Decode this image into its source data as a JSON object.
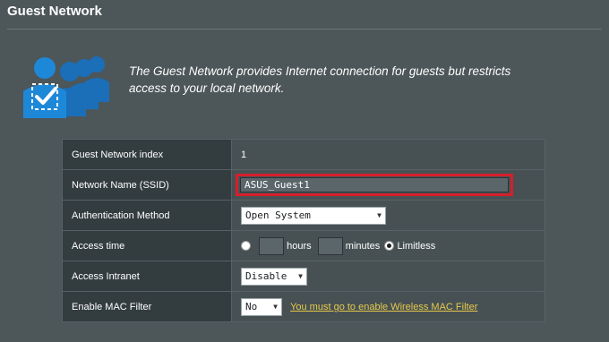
{
  "header": {
    "title": "Guest Network"
  },
  "intro": {
    "icon": "guest-users-check-icon",
    "text": "The Guest Network provides Internet connection for guests but restricts access to your local network."
  },
  "form": {
    "index": {
      "label": "Guest Network index",
      "value": "1"
    },
    "ssid": {
      "label": "Network Name (SSID)",
      "value": "ASUS_Guest1"
    },
    "auth": {
      "label": "Authentication Method",
      "value": "Open System"
    },
    "access_time": {
      "label": "Access time",
      "hours_label": "hours",
      "minutes_label": "minutes",
      "limitless_label": "Limitless",
      "selected": "Limitless"
    },
    "intranet": {
      "label": "Access Intranet",
      "value": "Disable"
    },
    "mac_filter": {
      "label": "Enable MAC Filter",
      "value": "No",
      "link_text": "You must go to enable Wireless MAC Filter"
    }
  },
  "colors": {
    "background": "#4d5659",
    "highlight_border": "#d61f2a",
    "link": "#e6c94a",
    "icon_blue": "#1e88d8"
  }
}
